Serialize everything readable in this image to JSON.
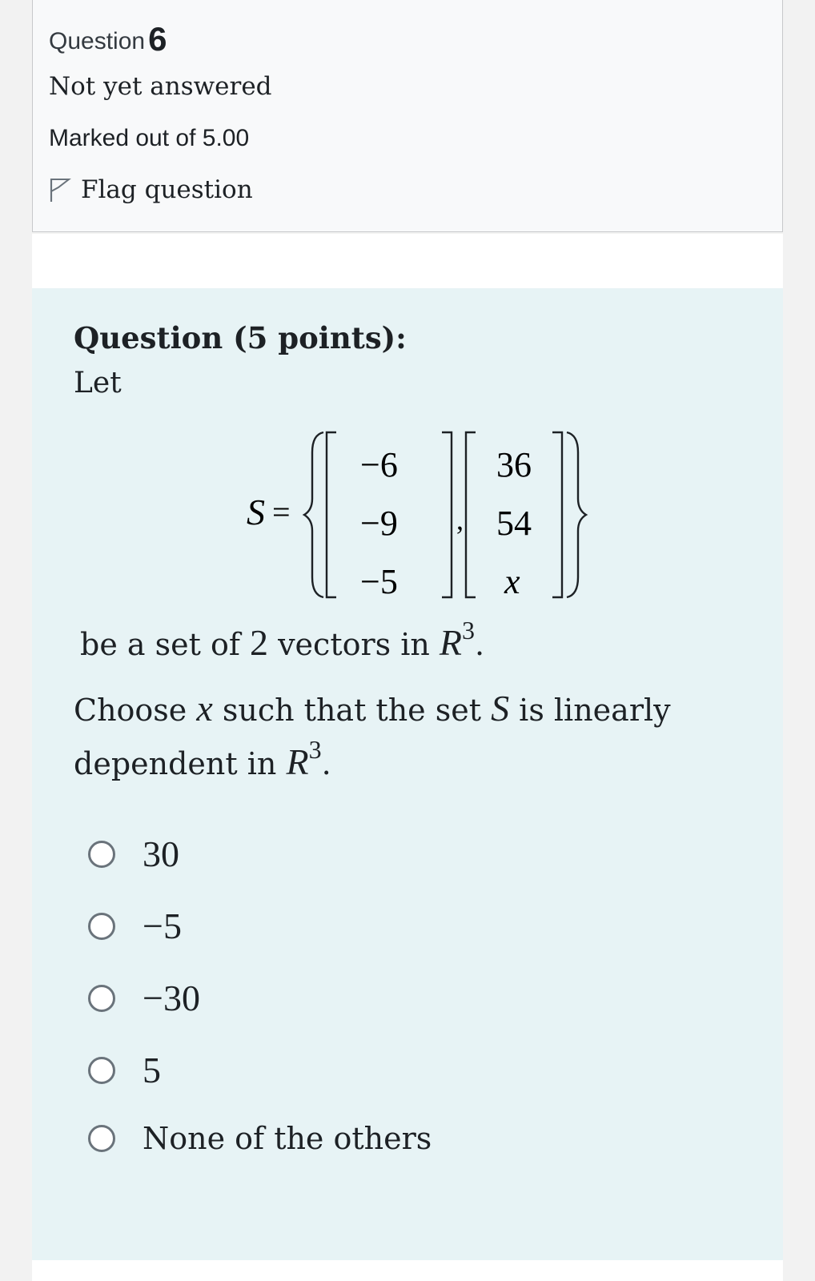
{
  "info": {
    "question_label": "Question",
    "question_number": "6",
    "state": "Not yet answered",
    "grade": "Marked out of 5.00",
    "flag_label": "Flag question",
    "flag_icon": "flag-outline-icon"
  },
  "question": {
    "title": "Question (5 points):",
    "intro": "Let",
    "set_name": "S",
    "equals": "=",
    "vector1": [
      "−6",
      "−9",
      "−5"
    ],
    "vector2": [
      "36",
      "54",
      "x"
    ],
    "line1_pre": "be a set of ",
    "line1_count": "2",
    "line1_mid": " vectors in ",
    "space_symbol": "R",
    "space_exp": "3",
    "period": ".",
    "line2_pre": "Choose ",
    "var_x": "x",
    "line2_mid": " such that the set ",
    "line2_post": " is linearly",
    "line3_pre": "dependent in "
  },
  "answers": [
    {
      "label": "30"
    },
    {
      "label": "−5"
    },
    {
      "label": "−30"
    },
    {
      "label": "5"
    },
    {
      "label": "None of the others"
    }
  ],
  "colors": {
    "formulation_bg": "#e7f3f5",
    "info_bg": "#f8f9fa",
    "radio_border": "#6a737b"
  }
}
